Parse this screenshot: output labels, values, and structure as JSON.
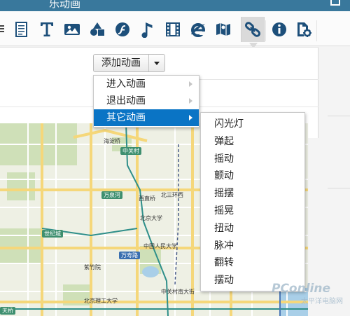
{
  "header": {
    "title": "乐动画"
  },
  "toolbar": {
    "buttons": [
      {
        "name": "list-icon"
      },
      {
        "name": "text-icon"
      },
      {
        "name": "image-icon"
      },
      {
        "name": "shapes-icon"
      },
      {
        "name": "flash-icon"
      },
      {
        "name": "music-icon"
      },
      {
        "name": "video-icon"
      },
      {
        "name": "ie-icon"
      },
      {
        "name": "map-icon"
      },
      {
        "name": "link-icon"
      },
      {
        "name": "info-icon"
      },
      {
        "name": "settings-icon"
      }
    ],
    "active": "link-icon"
  },
  "animation": {
    "add_label": "添加动画"
  },
  "menu": {
    "items": [
      {
        "label": "进入动画"
      },
      {
        "label": "退出动画"
      },
      {
        "label": "其它动画",
        "selected": true
      }
    ]
  },
  "submenu": {
    "items": [
      "闪光灯",
      "弹起",
      "摇动",
      "颤动",
      "摇摆",
      "摇晃",
      "扭动",
      "脉冲",
      "翻转",
      "摆动"
    ]
  },
  "map": {
    "labels": {
      "haidian": "海淀桥",
      "zhongguancun": "中关村",
      "wanquan": "万泉河",
      "beisihuan": "北三环西",
      "xizhi": "西直桥",
      "shijicheng": "世纪城",
      "beida": "北京大学",
      "renda": "中国人民大学",
      "wanshou": "万寿路",
      "zizhuyuan": "紫竹院",
      "yiheyuan": "中关村南大街",
      "tianqiao": "天桥",
      "bj": "北京理工大学"
    }
  },
  "watermark": {
    "brand": "PConline",
    "sub": "太平洋电脑网"
  }
}
